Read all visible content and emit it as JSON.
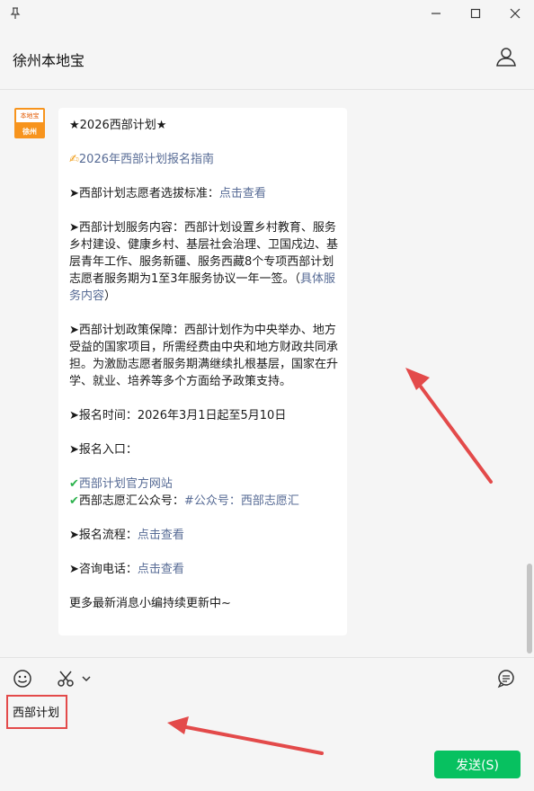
{
  "window": {
    "pin_icon": "pin-icon",
    "minimize_icon": "minimize-icon",
    "maximize_icon": "maximize-icon",
    "close_icon": "close-icon"
  },
  "header": {
    "title": "徐州本地宝",
    "profile_icon": "person-icon"
  },
  "message": {
    "avatar_top": "本地宝",
    "avatar_bottom": "徐州",
    "title": "★2026西部计划★",
    "guide_link": "2026年西部计划报名指南",
    "standard_label": "➤西部计划志愿者选拔标准：",
    "standard_link": "点击查看",
    "service_text": "➤西部计划服务内容：西部计划设置乡村教育、服务乡村建设、健康乡村、基层社会治理、卫国戍边、基层青年工作、服务新疆、服务西藏8个专项西部计划志愿者服务期为1至3年服务协议一年一签。（",
    "service_link": "具体服务内容",
    "service_close": "）",
    "policy_text": "➤西部计划政策保障：西部计划作为中央举办、地方受益的国家项目，所需经费由中央和地方财政共同承担。为激励志愿者服务期满继续扎根基层，国家在升学、就业、培养等多个方面给予政策支持。",
    "time_text": "➤报名时间：2026年3月1日起至5月10日",
    "entry_label": "➤报名入口：",
    "official_site_link": "西部计划官方网站",
    "account_label": "西部志愿汇公众号：",
    "account_link": "#公众号：西部志愿汇",
    "process_label": "➤报名流程：",
    "process_link": "点击查看",
    "phone_label": "➤咨询电话：",
    "phone_link": "点击查看",
    "footer": "更多最新消息小编持续更新中~"
  },
  "toolbar": {
    "emoji_icon": "emoji-icon",
    "scissors_icon": "scissors-icon",
    "chevron_icon": "chevron-down-icon",
    "chat_history_icon": "chat-history-icon"
  },
  "input": {
    "value": "西部计划"
  },
  "send_button": {
    "label": "发送(S)"
  },
  "colors": {
    "link": "#576b95",
    "send": "#07c160",
    "annotation": "#e34a4a"
  }
}
